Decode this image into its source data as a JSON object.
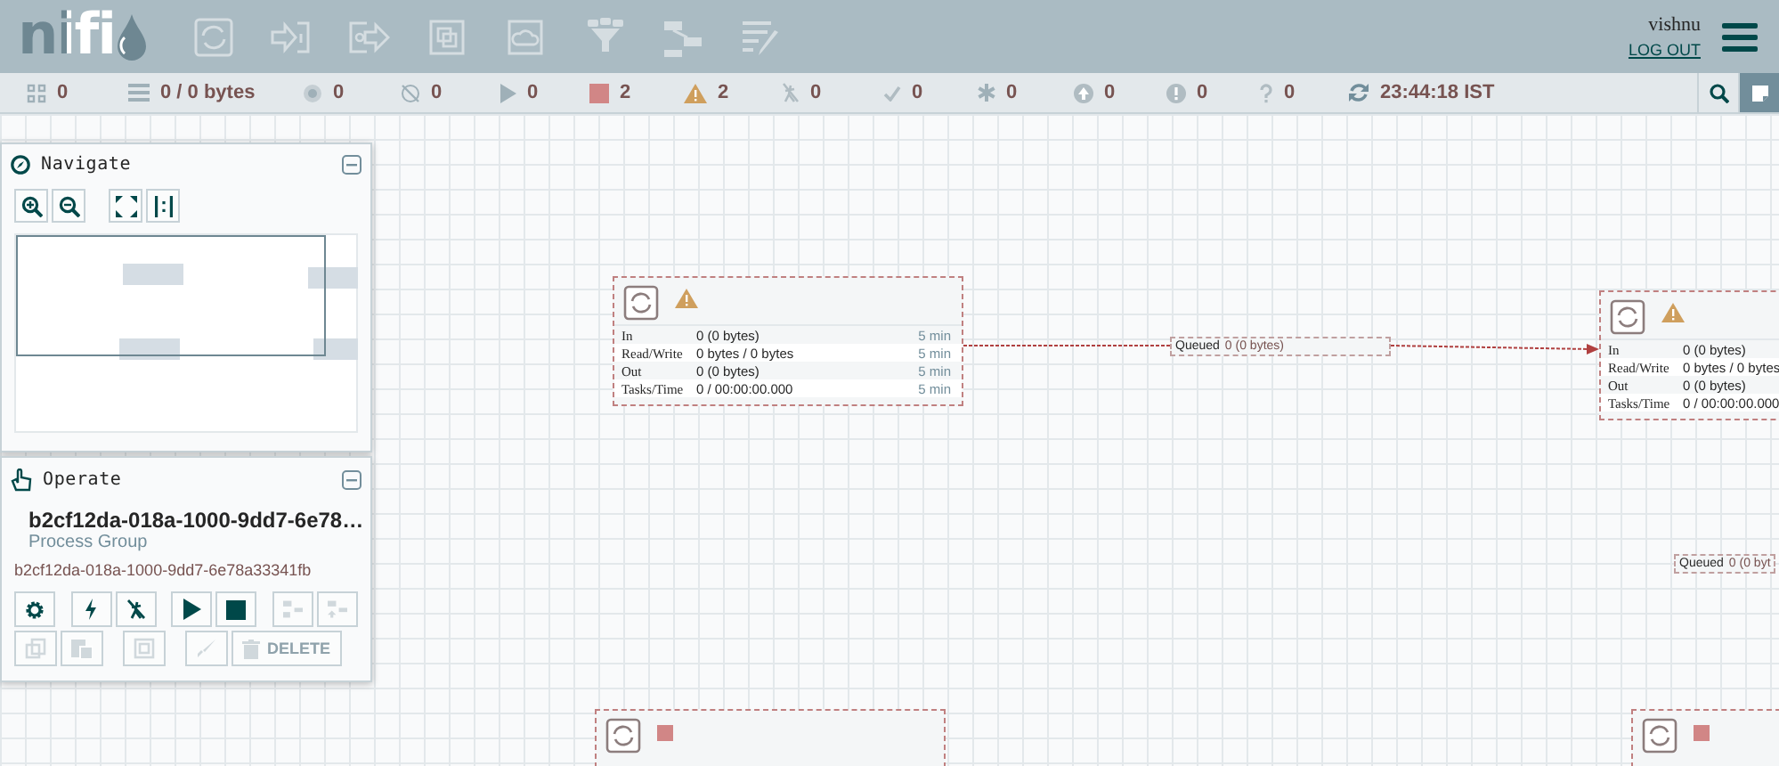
{
  "header": {
    "logo": "nifi",
    "user": "vishnu",
    "logout": "LOG OUT"
  },
  "status_bar": [
    {
      "kind": "threads",
      "value": "0"
    },
    {
      "kind": "queued",
      "value": "0 / 0 bytes"
    },
    {
      "kind": "transmitting",
      "value": "0"
    },
    {
      "kind": "not-transmitting",
      "value": "0"
    },
    {
      "kind": "running",
      "value": "0"
    },
    {
      "kind": "stopped",
      "value": "2"
    },
    {
      "kind": "invalid",
      "value": "2"
    },
    {
      "kind": "disabled",
      "value": "0"
    },
    {
      "kind": "up-to-date",
      "value": "0"
    },
    {
      "kind": "modified",
      "value": "0"
    },
    {
      "kind": "stale",
      "value": "0"
    },
    {
      "kind": "modified-stale",
      "value": "0"
    },
    {
      "kind": "sync-failure",
      "value": "0"
    },
    {
      "kind": "refresh",
      "value": "23:44:18 IST"
    }
  ],
  "navigate": {
    "title": "Navigate"
  },
  "operate": {
    "title": "Operate",
    "name": "b2cf12da-018a-1000-9dd7-6e78…",
    "type": "Process Group",
    "id": "b2cf12da-018a-1000-9dd7-6e78a33341fb",
    "buttons": [
      {
        "kind": "configure",
        "disabled": false
      },
      {
        "kind": "enable",
        "disabled": false
      },
      {
        "kind": "disable",
        "disabled": false
      },
      {
        "kind": "start",
        "disabled": false
      },
      {
        "kind": "stop",
        "disabled": false
      },
      {
        "kind": "create-template",
        "disabled": true
      },
      {
        "kind": "upload-template",
        "disabled": true
      },
      {
        "kind": "copy",
        "disabled": true
      },
      {
        "kind": "paste",
        "disabled": true
      },
      {
        "kind": "group",
        "disabled": true
      },
      {
        "kind": "color",
        "disabled": true
      },
      {
        "kind": "delete",
        "disabled": true,
        "label": "DELETE"
      }
    ]
  },
  "canvas": {
    "processors": [
      {
        "kind": "invalid",
        "stats": [
          {
            "label": "In",
            "value": "**0** (0 bytes)",
            "period": "5 min"
          },
          {
            "label": "Read/Write",
            "value": "0 bytes / 0 bytes",
            "period": "5 min"
          },
          {
            "label": "Out",
            "value": "**0** (0 bytes)",
            "period": "5 min"
          },
          {
            "label": "Tasks/Time",
            "value": "0 / 00:00:00.000",
            "period": "5 min"
          }
        ]
      },
      {
        "kind": "invalid",
        "stats": [
          {
            "label": "In",
            "value": "**0** (0 bytes)"
          },
          {
            "label": "Read/Write",
            "value": "0 bytes / 0 bytes"
          },
          {
            "label": "Out",
            "value": "**0** (0 bytes)"
          },
          {
            "label": "Tasks/Time",
            "value": "0 / 00:00:00.000"
          }
        ]
      },
      {
        "kind": "stopped"
      },
      {
        "kind": "stopped"
      }
    ],
    "connections": [
      {
        "label": "Queued",
        "value": "0 (0 bytes)"
      },
      {
        "label": "Queued",
        "value": "0 (0 byt"
      }
    ]
  }
}
